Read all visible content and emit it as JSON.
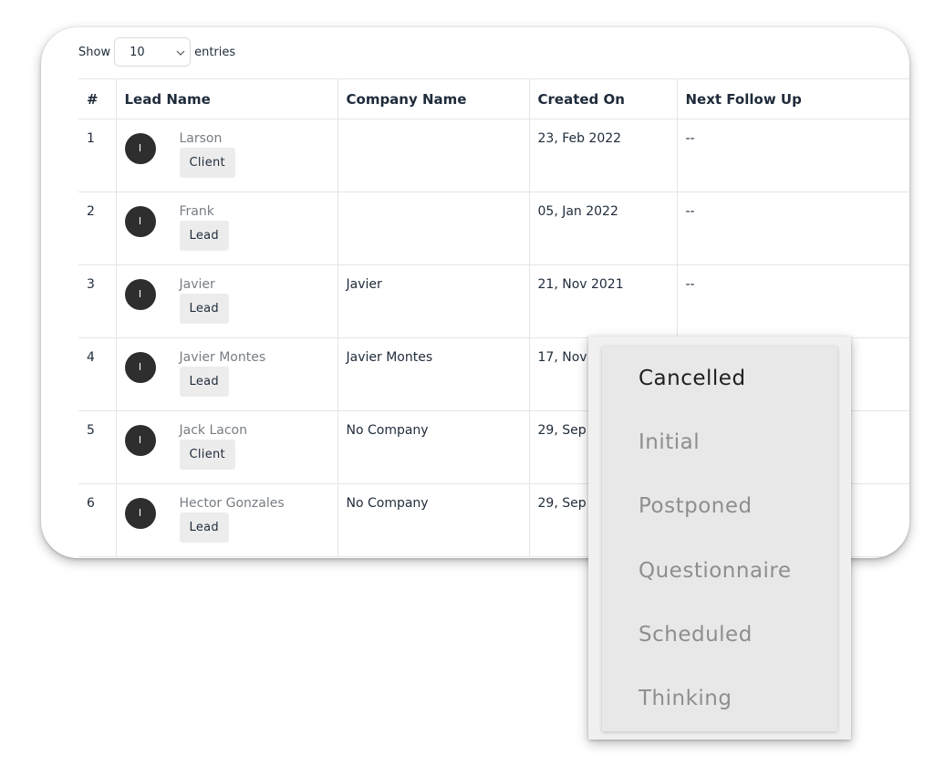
{
  "length_menu": {
    "show_label": "Show",
    "value": "10",
    "entries_label": "entries"
  },
  "table": {
    "headers": [
      "#",
      "Lead Name",
      "Company Name",
      "Created On",
      "Next Follow Up"
    ],
    "rows": [
      {
        "num": "1",
        "avatar": "I",
        "name": "Larson",
        "badge": "Client",
        "company": "",
        "created": "23, Feb 2022",
        "follow_up": "--"
      },
      {
        "num": "2",
        "avatar": "I",
        "name": "Frank",
        "badge": "Lead",
        "company": "",
        "created": "05, Jan 2022",
        "follow_up": "--"
      },
      {
        "num": "3",
        "avatar": "I",
        "name": "Javier",
        "badge": "Lead",
        "company": "Javier",
        "created": "21, Nov 2021",
        "follow_up": "--"
      },
      {
        "num": "4",
        "avatar": "I",
        "name": "Javier Montes",
        "badge": "Lead",
        "company": "Javier Montes",
        "created": "17, Nov",
        "follow_up": ""
      },
      {
        "num": "5",
        "avatar": "I",
        "name": "Jack Lacon",
        "badge": "Client",
        "company": "No Company",
        "created": "29, Sep",
        "follow_up": ""
      },
      {
        "num": "6",
        "avatar": "I",
        "name": "Hector Gonzales",
        "badge": "Lead",
        "company": "No Company",
        "created": "29, Sep",
        "follow_up": ""
      }
    ]
  },
  "status_dropdown": {
    "selected": "Cancelled",
    "options": [
      "Cancelled",
      "Initial",
      "Postponed",
      "Questionnaire",
      "Scheduled",
      "Thinking"
    ]
  },
  "icons": {
    "select_chevron": "chevron-down-icon"
  }
}
